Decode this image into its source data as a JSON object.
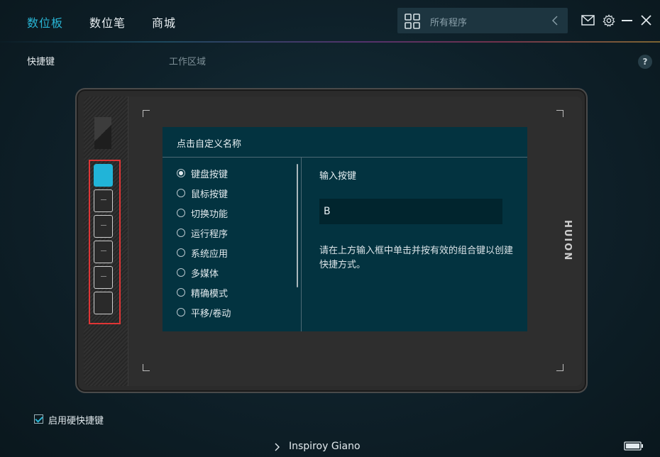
{
  "nav": {
    "tabs": [
      {
        "label": "数位板",
        "active": true
      },
      {
        "label": "数位笔",
        "active": false
      },
      {
        "label": "商城",
        "active": false
      }
    ]
  },
  "search": {
    "placeholder": "所有程序",
    "icon": "grid-icon"
  },
  "window_controls": [
    "mail-icon",
    "gear-icon",
    "minimize-icon",
    "close-icon"
  ],
  "subnav": {
    "tabs": [
      {
        "label": "快捷键",
        "active": true
      },
      {
        "label": "工作区域",
        "active": false
      }
    ],
    "help": "?"
  },
  "tablet": {
    "brand": "HUION",
    "express_keys_selected": 1,
    "express_key_count": 6
  },
  "dialog": {
    "title": "点击自定义名称",
    "options": [
      {
        "label": "键盘按键",
        "checked": true
      },
      {
        "label": "鼠标按键",
        "checked": false
      },
      {
        "label": "切换功能",
        "checked": false
      },
      {
        "label": "运行程序",
        "checked": false
      },
      {
        "label": "系统应用",
        "checked": false
      },
      {
        "label": "多媒体",
        "checked": false
      },
      {
        "label": "精确模式",
        "checked": false
      },
      {
        "label": "平移/卷动",
        "checked": false
      }
    ],
    "input_title": "输入按键",
    "input_value": "B",
    "hint": "请在上方输入框中单击并按有效的组合键以创建快捷方式。"
  },
  "footer": {
    "hw_shortcut_label": "启用硬快捷键",
    "hw_shortcut_checked": true,
    "device_name": "Inspiroy Giano"
  },
  "colors": {
    "accent": "#29b6d6",
    "dialog_bg": "#033340",
    "highlight_frame": "#e03535"
  }
}
